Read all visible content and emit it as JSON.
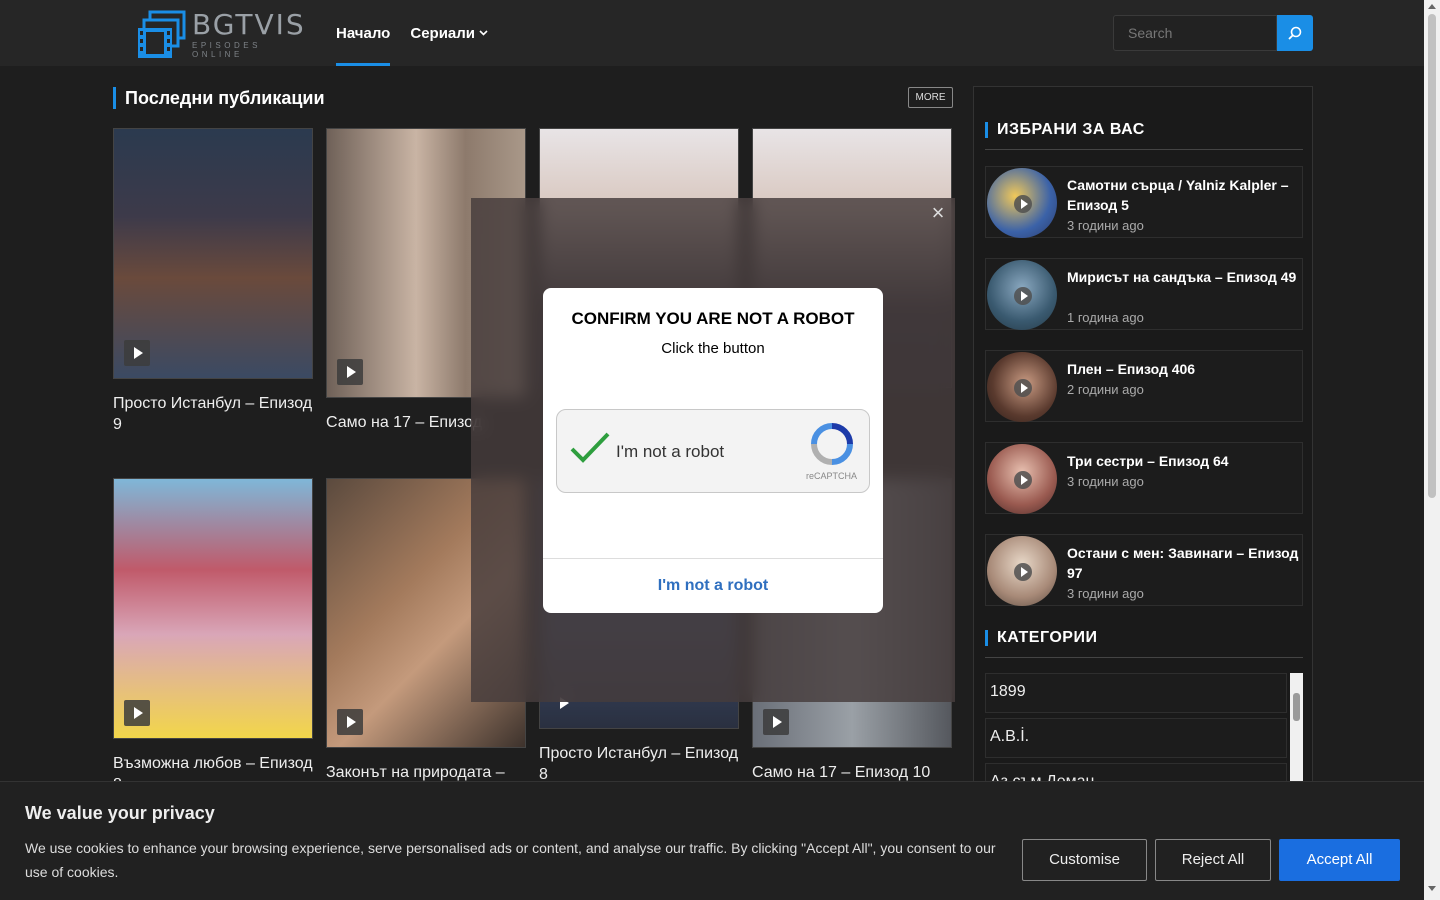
{
  "header": {
    "logo_title": "BGTVIS",
    "logo_sub": "EPISODES ONLINE",
    "nav": [
      {
        "label": "Начало",
        "active": true
      },
      {
        "label": "Сериали",
        "has_dropdown": true
      }
    ],
    "search_placeholder": "Search"
  },
  "main": {
    "section_title": "Последни публикации",
    "more_label": "MORE",
    "cards": [
      {
        "title": "Просто Истанбул – Епизод 9"
      },
      {
        "title": "Само на 17 – Епизод"
      },
      {
        "title": ""
      },
      {
        "title": ""
      },
      {
        "title": "Възможна любов – Епизод 8"
      },
      {
        "title": "Законът на природата –"
      },
      {
        "title": "Просто Истанбул – Епизод 8"
      },
      {
        "title": "Само на 17 – Епизод 10"
      }
    ]
  },
  "sidebar": {
    "featured_title": "ИЗБРАНИ ЗА ВАС",
    "featured": [
      {
        "title": "Самотни сърца / Yalniz Kalpler – Епизод 5",
        "time": "3 години ago"
      },
      {
        "title": "Мирисът на сандъка – Епизод 49",
        "time": "1 година ago"
      },
      {
        "title": "Плен – Епизод 406",
        "time": "2 години ago"
      },
      {
        "title": "Три сестри – Епизод 64",
        "time": "3 години ago"
      },
      {
        "title": "Остани с мен: Завинаги – Епизод 97",
        "time": "3 години ago"
      }
    ],
    "categories_title": "КАТЕГОРИИ",
    "categories": [
      "1899",
      "A.B.İ.",
      "Аз съм Деман"
    ]
  },
  "overlay": {
    "title": "CONFIRM YOU ARE NOT A ROBOT",
    "subtitle": "Click the button",
    "captcha_label": "I'm not a robot",
    "captcha_brand": "reCAPTCHA",
    "button_label": "I'm not a robot",
    "close_glyph": "×"
  },
  "cookie": {
    "title": "We value your privacy",
    "text": "We use cookies to enhance your browsing experience, serve personalised ads or content, and analyse our traffic. By clicking \"Accept All\", you consent to our use of cookies.",
    "customise": "Customise",
    "reject": "Reject All",
    "accept": "Accept All"
  },
  "colors": {
    "accent": "#1a8ee6",
    "accept_button": "#1a6ee0",
    "background": "#1e1e1e"
  }
}
